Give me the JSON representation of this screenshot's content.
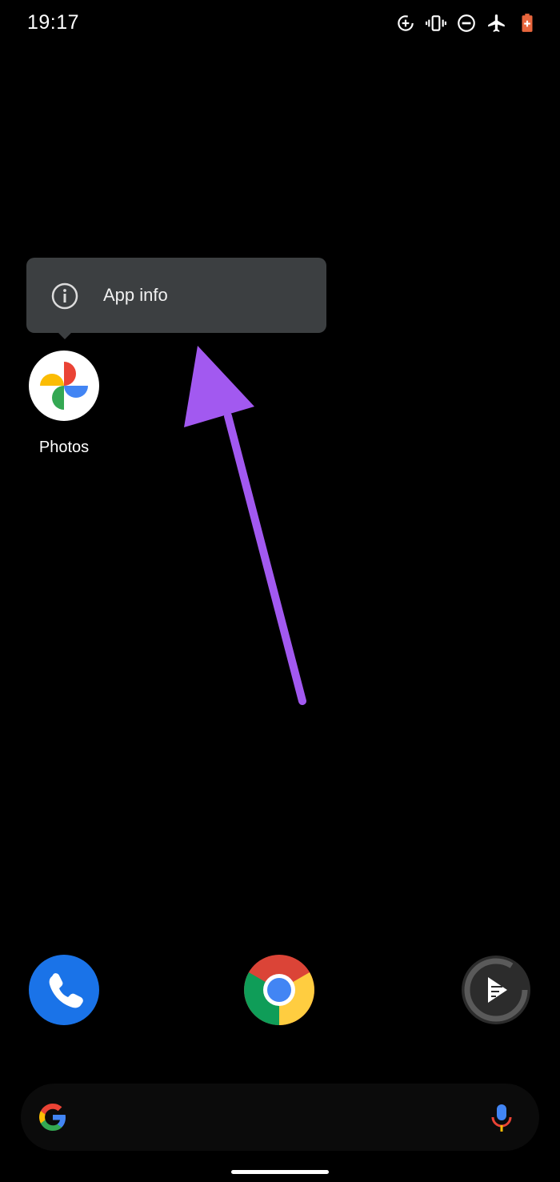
{
  "status_bar": {
    "time": "19:17",
    "icons": [
      "data-saver-icon",
      "vibrate-icon",
      "do-not-disturb-icon",
      "airplane-mode-icon",
      "battery-saver-icon"
    ]
  },
  "popup": {
    "items": [
      {
        "label": "App info",
        "icon": "info-icon"
      }
    ]
  },
  "home": {
    "apps": [
      {
        "label": "Photos",
        "icon": "google-photos-icon"
      }
    ]
  },
  "dock": {
    "apps": [
      {
        "icon": "phone-icon"
      },
      {
        "icon": "chrome-icon"
      },
      {
        "icon": "media-app-icon"
      }
    ]
  },
  "search_bar": {
    "left_icon": "google-g-icon",
    "right_icon": "microphone-icon"
  },
  "annotation": {
    "arrow_color": "#a259f0"
  },
  "colors": {
    "background": "#000000",
    "popup_bg": "#3c3f41"
  }
}
